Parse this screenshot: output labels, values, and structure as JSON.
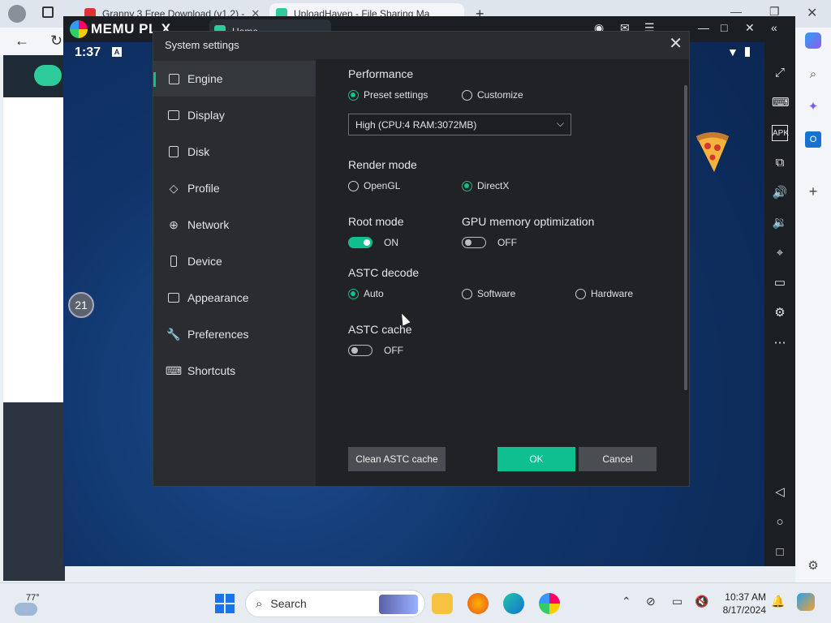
{
  "browser": {
    "tabs": [
      {
        "label": "Granny 3 Free Download (v1.2) -",
        "icon_color": "#d33"
      },
      {
        "label": "UploadHaven - File Sharing Ma",
        "icon_color": "#2ecc9a"
      }
    ],
    "new_tab_icon": "plus-icon"
  },
  "emulator": {
    "brand": "MEMU PL X",
    "home_tab": "Home",
    "status_time": "1:37",
    "status_badge": "A",
    "overlay_badge": "21"
  },
  "dialog": {
    "title": "System settings",
    "nav": [
      {
        "label": "Engine",
        "icon": "chip-icon",
        "active": true
      },
      {
        "label": "Display",
        "icon": "monitor-icon",
        "active": false
      },
      {
        "label": "Disk",
        "icon": "disk-icon",
        "active": false
      },
      {
        "label": "Profile",
        "icon": "tag-icon",
        "active": false
      },
      {
        "label": "Network",
        "icon": "globe-icon",
        "active": false
      },
      {
        "label": "Device",
        "icon": "phone-icon",
        "active": false
      },
      {
        "label": "Appearance",
        "icon": "window-icon",
        "active": false
      },
      {
        "label": "Preferences",
        "icon": "wrench-icon",
        "active": false
      },
      {
        "label": "Shortcuts",
        "icon": "keyboard-icon",
        "active": false
      }
    ],
    "performance": {
      "label": "Performance",
      "preset_label": "Preset settings",
      "customize_label": "Customize",
      "selected": "Preset settings",
      "select_value": "High (CPU:4 RAM:3072MB)"
    },
    "render_mode": {
      "label": "Render mode",
      "opengl_label": "OpenGL",
      "directx_label": "DirectX",
      "selected": "DirectX"
    },
    "root_mode": {
      "label": "Root mode",
      "state": "ON"
    },
    "gpu_opt": {
      "label": "GPU memory optimization",
      "state": "OFF"
    },
    "astc_decode": {
      "label": "ASTC decode",
      "auto_label": "Auto",
      "software_label": "Software",
      "hardware_label": "Hardware",
      "selected": "Auto"
    },
    "astc_cache": {
      "label": "ASTC cache",
      "state": "OFF"
    },
    "buttons": {
      "clean": "Clean ASTC cache",
      "ok": "OK",
      "cancel": "Cancel"
    }
  },
  "taskbar": {
    "temp": "77°",
    "search_placeholder": "Search",
    "time": "10:37 AM",
    "date": "8/17/2024"
  },
  "colors": {
    "accent": "#0fbf8f",
    "dialog_bg": "#202226",
    "nav_bg": "#2a2c30"
  }
}
